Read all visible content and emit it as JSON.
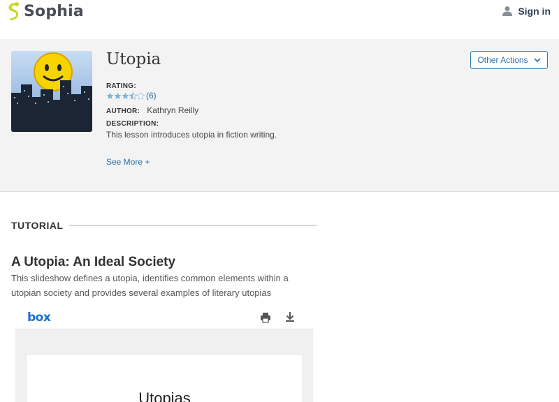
{
  "header": {
    "brand": "Sophia",
    "signin_label": "Sign in"
  },
  "resource": {
    "title": "Utopia",
    "rating_label": "RATING:",
    "rating_stars": 3.5,
    "rating_max": 5,
    "rating_count": "(6)",
    "author_label": "AUTHOR:",
    "author": "Kathryn Reilly",
    "description_label": "DESCRIPTION:",
    "description": "This lesson introduces utopia in fiction writing.",
    "see_more": "See More +",
    "other_actions": "Other Actions"
  },
  "tutorial": {
    "heading": "TUTORIAL",
    "lesson_title": "A Utopia: An Ideal Society",
    "lesson_description": "This slideshow defines a utopia, identifies common elements within a utopian society and provides several examples of literary utopias"
  },
  "viewer": {
    "brand": "box",
    "slide_title": "Utopias"
  },
  "colors": {
    "brand_green": "#c9d82b",
    "link_blue": "#2a6fa8",
    "panel_bg": "#f3f3f3",
    "star_filled": "#7fb4d6"
  }
}
